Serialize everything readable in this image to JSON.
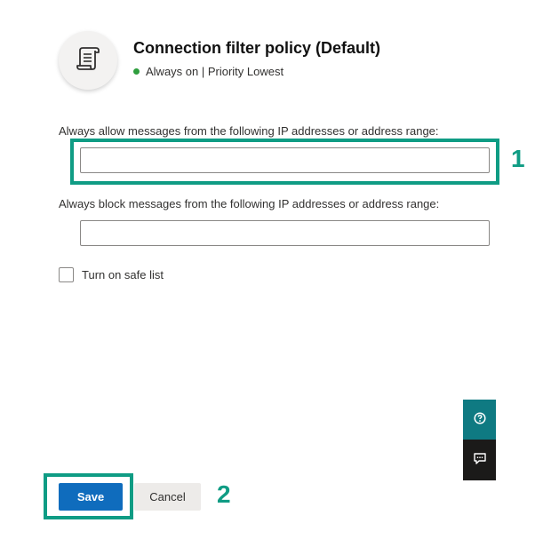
{
  "header": {
    "title": "Connection filter policy (Default)",
    "status": "Always on | Priority Lowest",
    "icon": "scroll-icon"
  },
  "form": {
    "allow_label": "Always allow messages from the following IP addresses or address range:",
    "allow_value": "",
    "block_label": "Always block messages from the following IP addresses or address range:",
    "block_value": "",
    "safe_list_label": "Turn on safe list",
    "safe_list_checked": false
  },
  "side_buttons": {
    "help_icon": "help-icon",
    "feedback_icon": "feedback-icon"
  },
  "footer": {
    "save_label": "Save",
    "cancel_label": "Cancel"
  },
  "callouts": {
    "one": "1",
    "two": "2"
  },
  "colors": {
    "highlight": "#0f9c84",
    "primary": "#0f6cbd",
    "status_on": "#2e9e3e"
  }
}
